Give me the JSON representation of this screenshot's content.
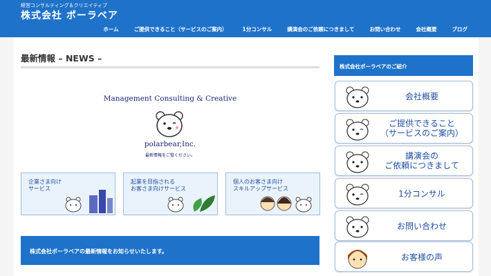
{
  "header": {
    "tagline": "経営コンサルティング＆クリエイティブ",
    "site_title": "株式会社 ポーラベア",
    "nav": [
      "ホーム",
      "ご提供できること（サービスのご案内）",
      "1分コンサル",
      "講演会のご依頼につきまして",
      "お問い合わせ",
      "会社概要",
      "ブログ"
    ]
  },
  "main": {
    "heading": "最新情報 – NEWS –",
    "hero_text": "Management Consulting & Creative",
    "logo_name": "polarbear,Inc.",
    "logo_sub": "最新情報をご覧ください。",
    "services": [
      {
        "line1": "企業さま向け",
        "line2": "サービス"
      },
      {
        "line1": "起業を目指される",
        "line2": "お客さま向けサービス"
      },
      {
        "line1": "個人のお客さま向け",
        "line2": "スキルアップサービス"
      }
    ],
    "news_banner": "株式会社ポーラベアの最新情報をお知らせいたします。"
  },
  "sidebar": {
    "title": "株式会社ポーラベアのご紹介",
    "items": [
      {
        "line1": "会社概要",
        "line2": ""
      },
      {
        "line1": "ご提供できること",
        "line2": "（サービスのご案内）"
      },
      {
        "line1": "講演会の",
        "line2": "ご依頼につきまして"
      },
      {
        "line1": "1分コンサル",
        "line2": ""
      },
      {
        "line1": "お問い合わせ",
        "line2": ""
      },
      {
        "line1": "お客様の声",
        "line2": ""
      }
    ]
  },
  "colors": {
    "brand": "#1f72c9",
    "text_blue": "#1f4ea3",
    "navy": "#1a237e"
  }
}
